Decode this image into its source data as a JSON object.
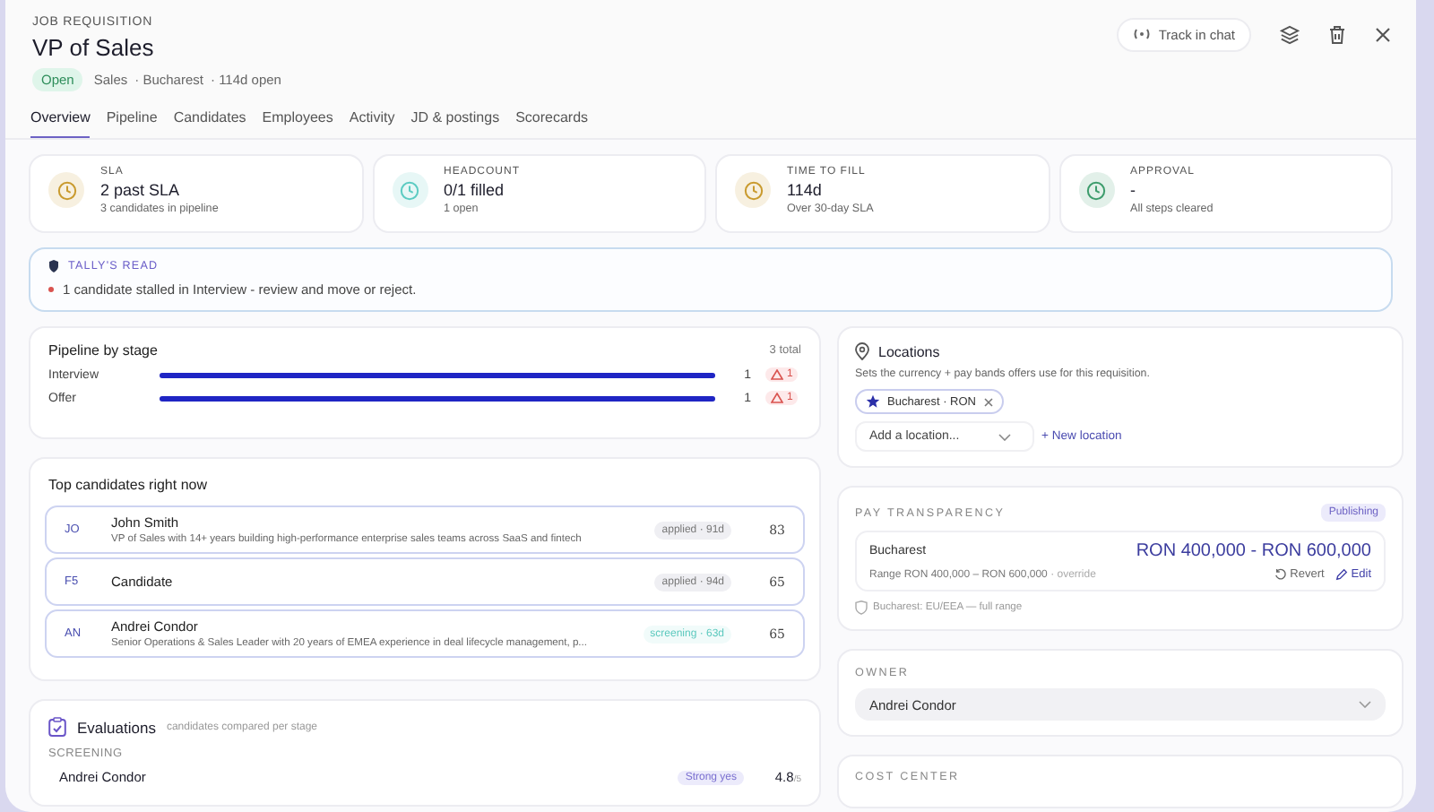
{
  "header": {
    "eyebrow": "JOB REQUISITION",
    "title": "VP of Sales",
    "status": "Open",
    "meta": [
      "Sales",
      "· Bucharest",
      "· 114d open"
    ],
    "track_button": "Track in chat"
  },
  "tabs": [
    {
      "label": "Overview",
      "selected": true
    },
    {
      "label": "Pipeline",
      "selected": false
    },
    {
      "label": "Candidates",
      "selected": false
    },
    {
      "label": "Employees",
      "selected": false
    },
    {
      "label": "Activity",
      "selected": false
    },
    {
      "label": "JD & postings",
      "selected": false
    },
    {
      "label": "Scorecards",
      "selected": false
    }
  ],
  "kpis": [
    {
      "label": "SLA",
      "value": "2 past SLA",
      "sub": "3 candidates in pipeline",
      "color": "#c99a2e"
    },
    {
      "label": "HEADCOUNT",
      "value": "0/1 filled",
      "sub": "1 open",
      "color": "#5ccbc2"
    },
    {
      "label": "TIME TO FILL",
      "value": "114d",
      "sub": "Over 30-day SLA",
      "color": "#c99a2e"
    },
    {
      "label": "APPROVAL",
      "value": "-",
      "sub": "All steps cleared",
      "color": "#3d9c6c"
    }
  ],
  "tally": {
    "title": "TALLY'S READ",
    "items": [
      "1 candidate stalled in Interview - review and move or reject."
    ]
  },
  "pipeline": {
    "title": "Pipeline by stage",
    "total": "3 total",
    "stages": [
      {
        "name": "Interview",
        "level": 1,
        "count": "1",
        "warnings": "1"
      },
      {
        "name": "Offer",
        "level": 1,
        "count": "1",
        "warnings": "1"
      }
    ]
  },
  "top_candidates": {
    "title": "Top candidates right now",
    "rows": [
      {
        "initials": "JO",
        "name": "John Smith",
        "summary": "VP of Sales with 14+ years building high-performance enterprise sales teams across SaaS and fintech",
        "tag": "applied · 91d",
        "kind": "applied",
        "score": "83"
      },
      {
        "initials": "F5",
        "name": "Candidate",
        "tag": "applied · 94d",
        "kind": "applied",
        "score": "65"
      },
      {
        "initials": "AN",
        "name": "Andrei Condor",
        "summary": "Senior Operations & Sales Leader with 20 years of EMEA experience in deal lifecycle management, p...",
        "tag": "screening · 63d",
        "kind": "screening",
        "score": "65"
      }
    ]
  },
  "evaluations": {
    "title": "Evaluations",
    "subtitle": "candidates compared per stage",
    "stage": "SCREENING",
    "rows": [
      {
        "name": "Andrei Condor",
        "verdict": "Strong yes",
        "score": "4.8",
        "out_of": "/5"
      }
    ]
  },
  "locations": {
    "title": "Locations",
    "description": "Sets the currency + pay bands offers use for this requisition.",
    "chips": [
      {
        "label": "Bucharest · RON"
      }
    ],
    "add_placeholder": "Add a location...",
    "new_link": "+ New location"
  },
  "pay": {
    "title": "PAY TRANSPARENCY",
    "badge": "Publishing",
    "location": "Bucharest",
    "range": "RON 400,000 - RON 600,000",
    "detail": "Range RON 400,000 – RON 600,000",
    "override": "· override",
    "revert": "Revert",
    "edit": "Edit",
    "note": "Bucharest: EU/EEA — full range"
  },
  "owner": {
    "label": "OWNER",
    "value": "Andrei Condor"
  },
  "cost_center": {
    "label": "COST CENTER"
  }
}
